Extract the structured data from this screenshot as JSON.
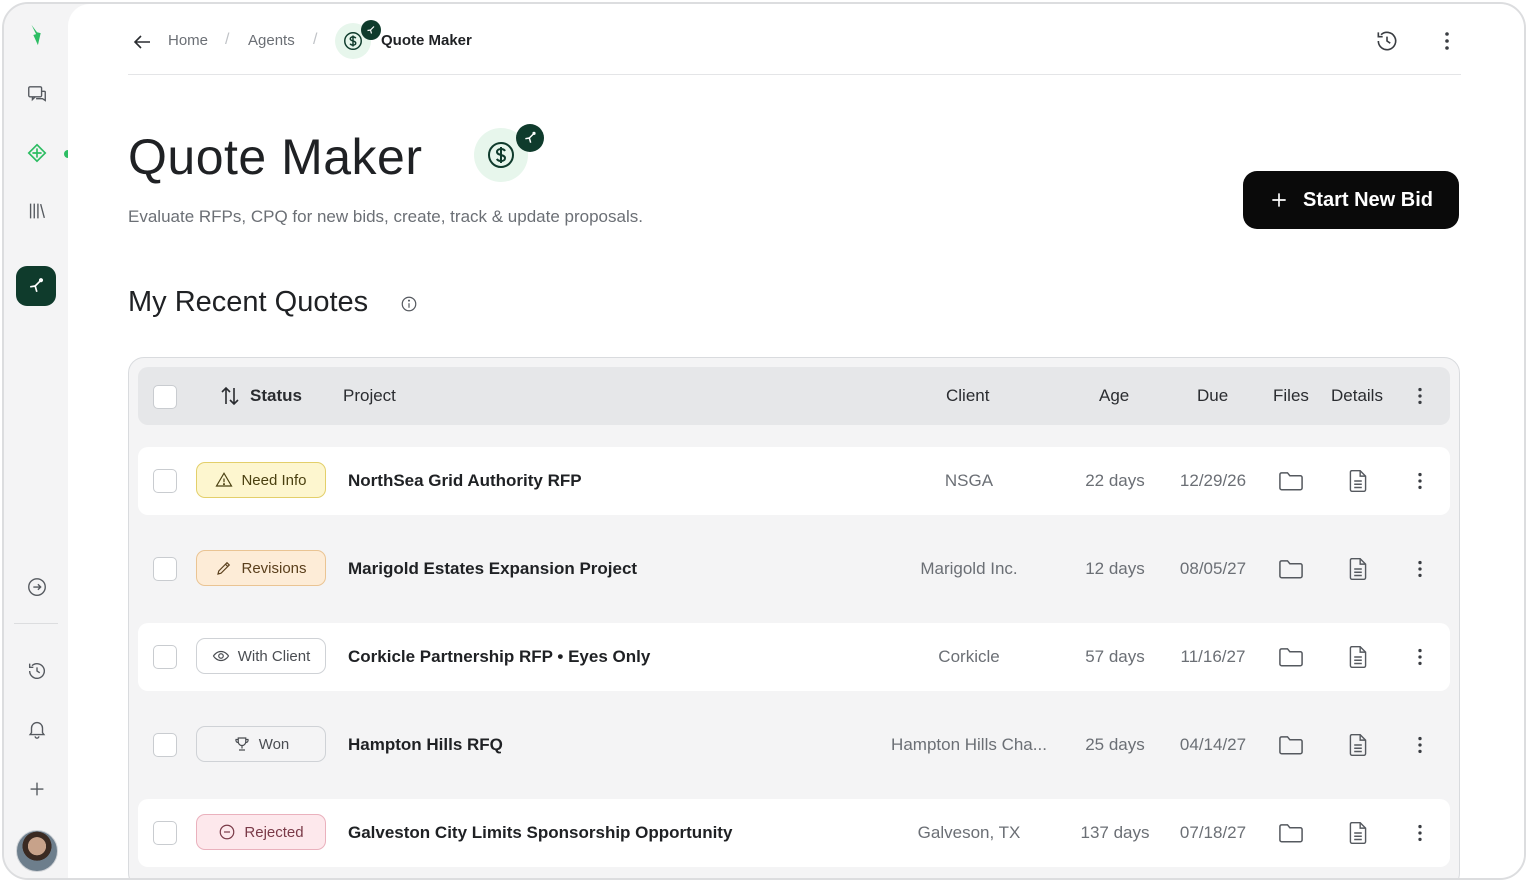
{
  "breadcrumb": {
    "home": "Home",
    "agents": "Agents",
    "current": "Quote Maker",
    "sep": "/"
  },
  "page": {
    "title": "Quote Maker",
    "subtitle": "Evaluate RFPs, CPQ for new bids, create, track & update proposals.",
    "cta_label": "Start New Bid",
    "section_title": "My Recent Quotes"
  },
  "table": {
    "headers": {
      "status": "Status",
      "project": "Project",
      "client": "Client",
      "age": "Age",
      "due": "Due",
      "files": "Files",
      "details": "Details"
    },
    "rows": [
      {
        "status": "Need Info",
        "project": "NorthSea Grid Authority RFP",
        "client": "NSGA",
        "age": "22 days",
        "due": "12/29/26"
      },
      {
        "status": "Revisions",
        "project": "Marigold Estates Expansion Project",
        "client": "Marigold Inc.",
        "age": "12 days",
        "due": "08/05/27"
      },
      {
        "status": "With Client",
        "project": "Corkicle Partnership RFP • Eyes Only",
        "client": "Corkicle",
        "age": "57 days",
        "due": "11/16/27"
      },
      {
        "status": "Won",
        "project": "Hampton Hills RFQ",
        "client": "Hampton Hills Cha...",
        "age": "25 days",
        "due": "04/14/27"
      },
      {
        "status": "Rejected",
        "project": "Galveston City Limits Sponsorship Opportunity",
        "client": "Galveson, TX",
        "age": "137 days",
        "due": "07/18/27"
      }
    ]
  },
  "colors": {
    "brand_green": "#2dbd63",
    "agent_dark": "#0f3b2c",
    "need_info_bg": "#fdf6cf",
    "need_info_border": "#e3cf6a",
    "revisions_bg": "#fdecd7",
    "revisions_border": "#eac493",
    "rejected_bg": "#fde8ec",
    "rejected_border": "#eab1bd"
  }
}
